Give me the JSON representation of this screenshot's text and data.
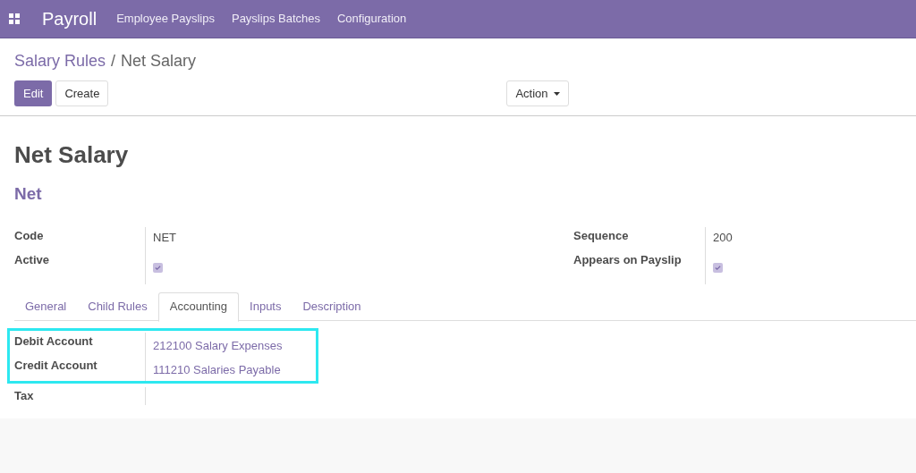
{
  "app_title": "Payroll",
  "menu": [
    "Employee Payslips",
    "Payslips Batches",
    "Configuration"
  ],
  "breadcrumb": {
    "parent": "Salary Rules",
    "separator": "/",
    "current": "Net Salary"
  },
  "buttons": {
    "edit": "Edit",
    "create": "Create",
    "action": "Action"
  },
  "record": {
    "name": "Net Salary",
    "category": "Net"
  },
  "left_fields": [
    {
      "label": "Code",
      "kind": "text",
      "value": "NET"
    },
    {
      "label": "Active",
      "kind": "checkbox",
      "checked": true
    }
  ],
  "right_fields": [
    {
      "label": "Sequence",
      "kind": "text",
      "value": "200"
    },
    {
      "label": "Appears on Payslip",
      "kind": "checkbox",
      "checked": true
    }
  ],
  "tabs": [
    {
      "label": "General",
      "selected": false
    },
    {
      "label": "Child Rules",
      "selected": false
    },
    {
      "label": "Accounting",
      "selected": true
    },
    {
      "label": "Inputs",
      "selected": false
    },
    {
      "label": "Description",
      "selected": false
    }
  ],
  "accounting": {
    "highlighted": [
      {
        "label": "Debit Account",
        "value": "212100 Salary Expenses"
      },
      {
        "label": "Credit Account",
        "value": "111210 Salaries Payable"
      }
    ],
    "other": [
      {
        "label": "Tax"
      }
    ]
  }
}
